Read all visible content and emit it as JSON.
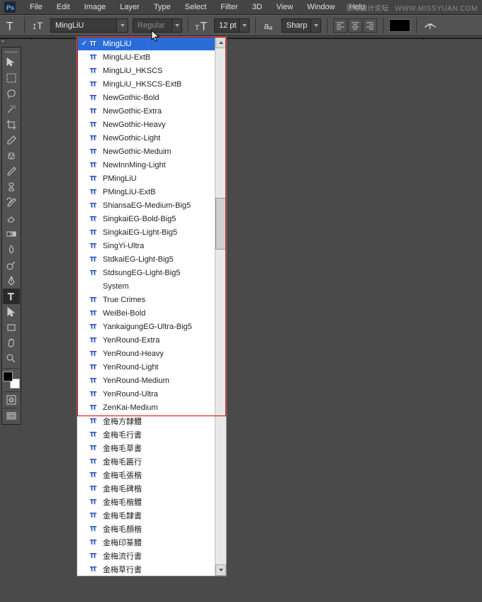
{
  "app": {
    "name": "Photoshop"
  },
  "menu": [
    "File",
    "Edit",
    "Image",
    "Layer",
    "Type",
    "Select",
    "Filter",
    "3D",
    "View",
    "Window",
    "Help"
  ],
  "watermark": {
    "text1": "思缘设计论坛",
    "text2": "WWW.MISSYUAN.COM"
  },
  "options": {
    "font_family": "MingLiU",
    "font_style": "Regular",
    "size": "12 pt",
    "antialias": "Sharp"
  },
  "font_dropdown": {
    "selected": "MingLiU",
    "items": [
      {
        "name": "MingLiU",
        "selected": true,
        "checked": true,
        "tt": true
      },
      {
        "name": "MingLiU-ExtB",
        "tt": true
      },
      {
        "name": "MingLiU_HKSCS",
        "tt": true
      },
      {
        "name": "MingLiU_HKSCS-ExtB",
        "tt": true
      },
      {
        "name": "NewGothic-Bold",
        "tt": true
      },
      {
        "name": "NewGothic-Extra",
        "tt": true
      },
      {
        "name": "NewGothic-Heavy",
        "tt": true
      },
      {
        "name": "NewGothic-Light",
        "tt": true
      },
      {
        "name": "NewGothic-Meduim",
        "tt": true
      },
      {
        "name": "NewInnMing-Light",
        "tt": true
      },
      {
        "name": "PMingLiU",
        "tt": true
      },
      {
        "name": "PMingLiU-ExtB",
        "tt": true
      },
      {
        "name": "ShiansaEG-Medium-Big5",
        "tt": true
      },
      {
        "name": "SingkaiEG-Bold-Big5",
        "tt": true
      },
      {
        "name": "SingkaiEG-Light-Big5",
        "tt": true
      },
      {
        "name": "SingYi-Ultra",
        "tt": true
      },
      {
        "name": "StdkaiEG-Light-Big5",
        "tt": true
      },
      {
        "name": "StdsungEG-Light-Big5",
        "tt": true
      },
      {
        "name": "System",
        "tt": false
      },
      {
        "name": "True Crimes",
        "tt": true
      },
      {
        "name": "WeiBei-Bold",
        "tt": true
      },
      {
        "name": "YankaigungEG-Ultra-Big5",
        "tt": true
      },
      {
        "name": "YenRound-Extra",
        "tt": true
      },
      {
        "name": "YenRound-Heavy",
        "tt": true
      },
      {
        "name": "YenRound-Light",
        "tt": true
      },
      {
        "name": "YenRound-Medium",
        "tt": true
      },
      {
        "name": "YenRound-Ultra",
        "tt": true
      },
      {
        "name": "ZenKai-Medium",
        "tt": true
      },
      {
        "name": "金梅方隸體",
        "tt": true
      },
      {
        "name": "金梅毛行書",
        "tt": true
      },
      {
        "name": "金梅毛草書",
        "tt": true
      },
      {
        "name": "金梅毛匾行",
        "tt": true
      },
      {
        "name": "金梅毛張楷",
        "tt": true
      },
      {
        "name": "金梅毛碑楷",
        "tt": true
      },
      {
        "name": "金梅毛楷體",
        "tt": true
      },
      {
        "name": "金梅毛隸書",
        "tt": true
      },
      {
        "name": "金梅毛顏楷",
        "tt": true
      },
      {
        "name": "金梅印篆體",
        "tt": true
      },
      {
        "name": "金梅流行書",
        "tt": true
      },
      {
        "name": "金梅草行書",
        "tt": true
      }
    ]
  },
  "tools": [
    "move-tool",
    "marquee-tool",
    "lasso-tool",
    "wand-tool",
    "crop-tool",
    "eyedropper-tool",
    "heal-tool",
    "brush-tool",
    "stamp-tool",
    "history-brush-tool",
    "eraser-tool",
    "gradient-tool",
    "blur-tool",
    "dodge-tool",
    "pen-tool",
    "type-tool",
    "path-select-tool",
    "rectangle-tool",
    "hand-tool",
    "zoom-tool"
  ]
}
